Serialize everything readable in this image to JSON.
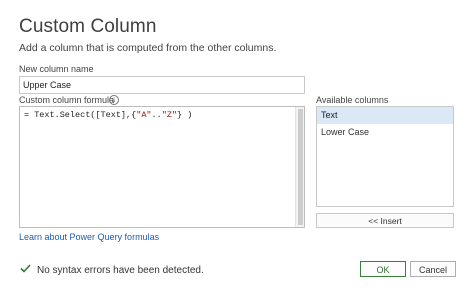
{
  "dialog": {
    "title": "Custom Column",
    "subtitle": "Add a column that is computed from the other columns."
  },
  "name_field": {
    "label": "New column name",
    "value": "Upper Case"
  },
  "formula": {
    "label": "Custom column formula",
    "info_icon": "i",
    "prefix": "= Text.Select([Text],{",
    "str1": "\"A\"",
    "mid": "..",
    "str2": "\"Z\"",
    "suffix": "} )"
  },
  "available": {
    "label": "Available columns",
    "items": [
      "Text",
      "Lower Case"
    ],
    "selected_index": 0,
    "insert_label": "<< Insert"
  },
  "learn_link": "Learn about Power Query formulas",
  "status": {
    "icon": "check-icon",
    "text": "No syntax errors have been detected.",
    "color": "#2e7d32"
  },
  "buttons": {
    "ok": "OK",
    "cancel": "Cancel"
  }
}
